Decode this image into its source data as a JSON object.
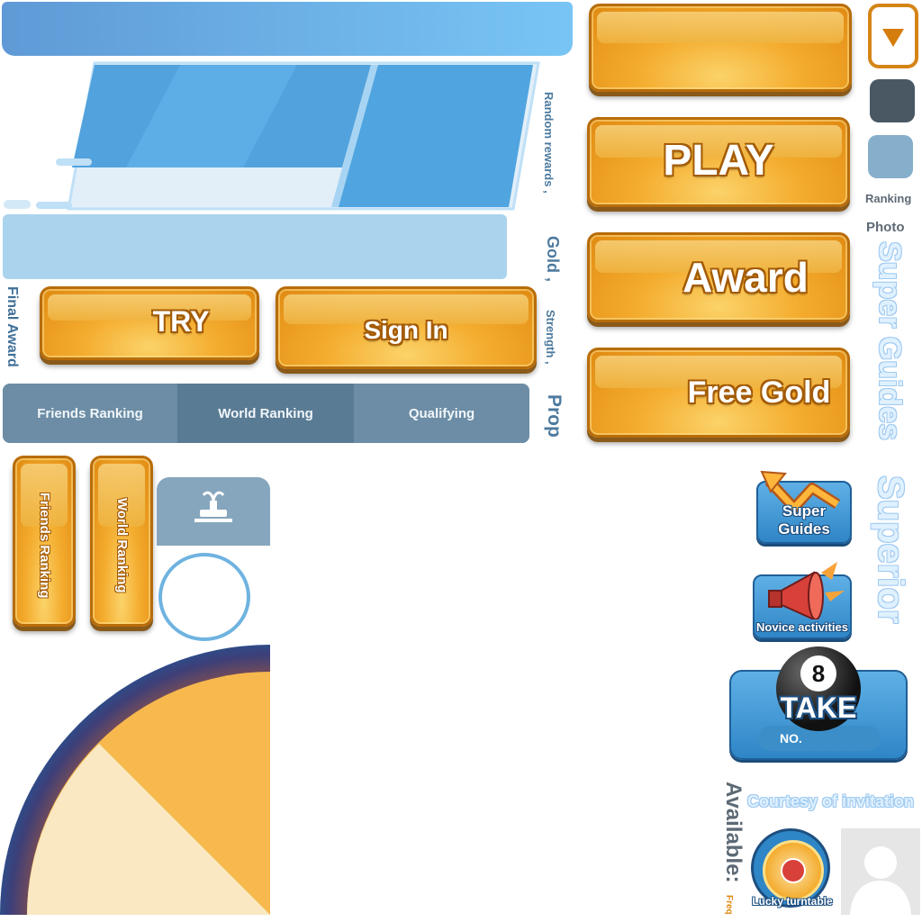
{
  "buttons": {
    "play": "PLAY",
    "award": "Award",
    "free_gold": "Free Gold",
    "try": "TRY",
    "sign_in": "Sign In",
    "friends_ranking_v": "Friends Ranking",
    "world_ranking_v": "World Ranking"
  },
  "tabs": [
    "Friends Ranking",
    "World Ranking",
    "Qualifying"
  ],
  "side_labels": {
    "random_rewards": "Random rewards ,",
    "gold": "Gold ,",
    "strength": "Strength ,",
    "prop": "Prop",
    "final_award": "Final Award",
    "ranking": "Ranking",
    "photo": "Photo",
    "available": "Available:",
    "freq": "Freq"
  },
  "outline_titles": {
    "super_guides": "Super Guides",
    "superior": "Superior",
    "courtesy": "Courtesy of invitation"
  },
  "tiles": {
    "super_guides": "Super Guides",
    "novice_activities": "Novice activities",
    "take": "TAKE",
    "no": "NO.",
    "ball_number": "8",
    "lucky_turntable": "Lucky turntable"
  },
  "colors": {
    "orange": "#f4ac2e",
    "blue": "#4fa7e0",
    "slate": "#6f90a8",
    "dark_square": "#4a5864",
    "light_square": "#86afcb"
  },
  "icons": {
    "dropdown": "triangle-down-icon",
    "fountain": "fountain-icon",
    "arrow": "zigzag-arrow-icon",
    "megaphone": "megaphone-icon",
    "billiard": "billiard-ball-icon",
    "wheel": "wheel-icon",
    "avatar": "avatar-placeholder-icon"
  }
}
